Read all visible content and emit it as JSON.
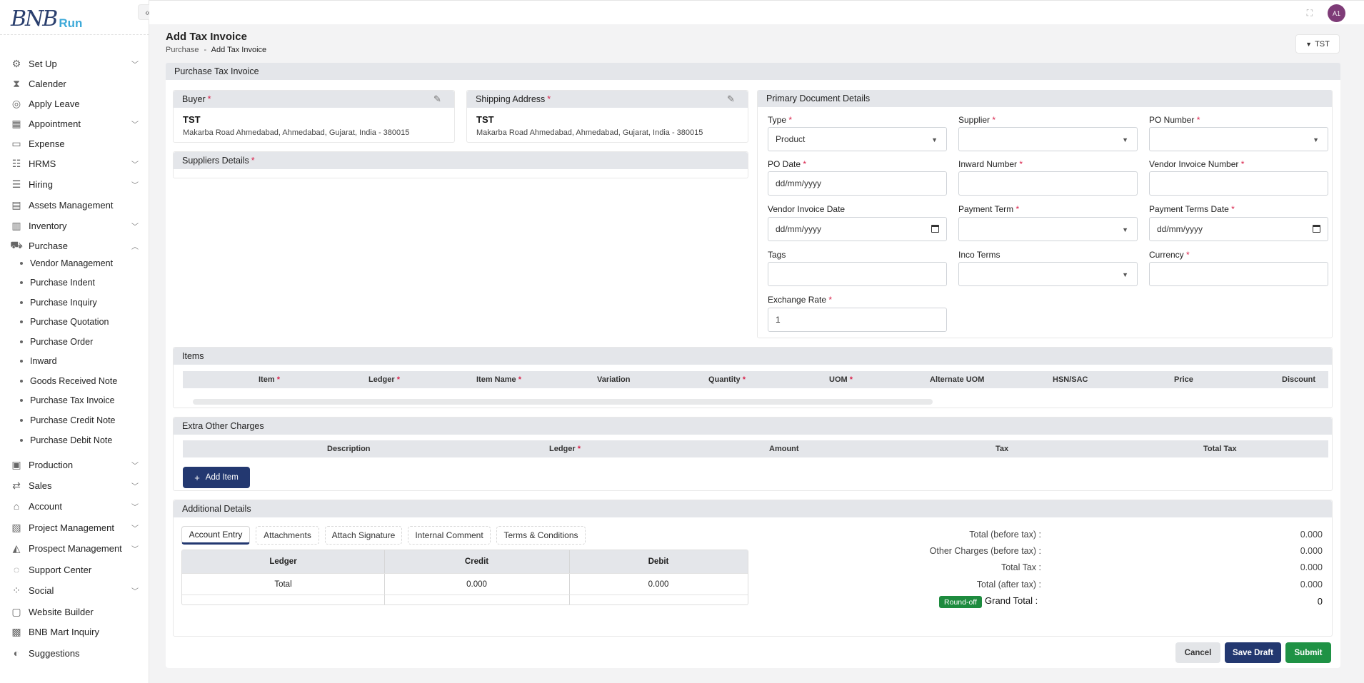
{
  "app": {
    "logo_mark": "BNB",
    "logo_suffix": "Run",
    "avatar": "A1"
  },
  "sidebar": {
    "items": [
      {
        "label": "Set Up",
        "icon": "setup-icon",
        "chevron": true
      },
      {
        "label": "Calender",
        "icon": "hourglass-icon",
        "chevron": false
      },
      {
        "label": "Apply Leave",
        "icon": "leave-icon",
        "chevron": false
      },
      {
        "label": "Appointment",
        "icon": "calendar-icon",
        "chevron": true
      },
      {
        "label": "Expense",
        "icon": "expense-icon",
        "chevron": false
      },
      {
        "label": "HRMS",
        "icon": "hrms-icon",
        "chevron": true
      },
      {
        "label": "Hiring",
        "icon": "hiring-icon",
        "chevron": true
      },
      {
        "label": "Assets Management",
        "icon": "assets-icon",
        "chevron": false
      },
      {
        "label": "Inventory",
        "icon": "inventory-icon",
        "chevron": true
      },
      {
        "label": "Purchase",
        "icon": "cart-icon",
        "chevron": true
      },
      {
        "label": "Production",
        "icon": "factory-icon",
        "chevron": true
      },
      {
        "label": "Sales",
        "icon": "sales-icon",
        "chevron": true
      },
      {
        "label": "Account",
        "icon": "bank-icon",
        "chevron": true
      },
      {
        "label": "Project Management",
        "icon": "project-icon",
        "chevron": true
      },
      {
        "label": "Prospect Management",
        "icon": "prospect-icon",
        "chevron": true
      },
      {
        "label": "Support Center",
        "icon": "support-icon",
        "chevron": false
      },
      {
        "label": "Social",
        "icon": "social-icon",
        "chevron": true
      },
      {
        "label": "Website Builder",
        "icon": "website-icon",
        "chevron": false
      },
      {
        "label": "BNB Mart Inquiry",
        "icon": "mart-icon",
        "chevron": false
      },
      {
        "label": "Suggestions",
        "icon": "toggle-icon",
        "chevron": false
      }
    ],
    "purchase_sub": [
      "Vendor Management",
      "Purchase Indent",
      "Purchase Inquiry",
      "Purchase Quotation",
      "Purchase Order",
      "Inward",
      "Goods Received Note",
      "Purchase Tax Invoice",
      "Purchase Credit Note",
      "Purchase Debit Note"
    ]
  },
  "page": {
    "title": "Add Tax Invoice",
    "breadcrumb_parent": "Purchase",
    "breadcrumb_sep": "-",
    "breadcrumb_current": "Add Tax Invoice",
    "filter_label": "TST",
    "section_title": "Purchase Tax Invoice"
  },
  "buyer": {
    "title": "Buyer",
    "name": "TST",
    "address": "Makarba Road Ahmedabad, Ahmedabad, Gujarat, India - 380015"
  },
  "shipping": {
    "title": "Shipping Address",
    "name": "TST",
    "address": "Makarba Road Ahmedabad, Ahmedabad, Gujarat, India - 380015"
  },
  "suppliers": {
    "title": "Suppliers Details"
  },
  "primary": {
    "title": "Primary Document Details",
    "type_label": "Type",
    "type_value": "Product",
    "supplier_label": "Supplier",
    "po_number_label": "PO Number",
    "po_date_label": "PO Date",
    "po_date_value": "dd/mm/yyyy",
    "inward_label": "Inward Number",
    "vendor_inv_no_label": "Vendor Invoice Number",
    "vendor_inv_date_label": "Vendor Invoice Date",
    "vendor_inv_date_value": "dd/mm/yyyy",
    "payment_term_label": "Payment Term",
    "payment_terms_date_label": "Payment Terms Date",
    "payment_terms_date_value": "dd/mm/yyyy",
    "tags_label": "Tags",
    "inco_label": "Inco Terms",
    "currency_label": "Currency",
    "exchange_label": "Exchange Rate",
    "exchange_value": "1"
  },
  "items": {
    "title": "Items",
    "columns": [
      "Item",
      "Ledger",
      "Item Name",
      "Variation",
      "Quantity",
      "UOM",
      "Alternate UOM",
      "HSN/SAC",
      "Price",
      "Discount"
    ]
  },
  "charges": {
    "title": "Extra Other Charges",
    "columns": [
      "Description",
      "Ledger",
      "Amount",
      "Tax",
      "Total Tax"
    ],
    "add_label": "Add Item"
  },
  "additional": {
    "title": "Additional Details",
    "tabs": [
      "Account Entry",
      "Attachments",
      "Attach Signature",
      "Internal Comment",
      "Terms & Conditions"
    ],
    "ledger_cols": [
      "Ledger",
      "Credit",
      "Debit"
    ],
    "ledger_total": {
      "label": "Total",
      "credit": "0.000",
      "debit": "0.000"
    }
  },
  "summary": {
    "before_tax_label": "Total (before tax) :",
    "before_tax": "0.000",
    "other_label": "Other Charges (before tax) :",
    "other": "0.000",
    "tax_label": "Total Tax :",
    "tax": "0.000",
    "after_tax_label": "Total (after tax) :",
    "after_tax": "0.000",
    "roundoff": "Round-off",
    "grand_label": "Grand Total :",
    "grand": "0"
  },
  "actions": {
    "cancel": "Cancel",
    "save": "Save Draft",
    "submit": "Submit"
  }
}
